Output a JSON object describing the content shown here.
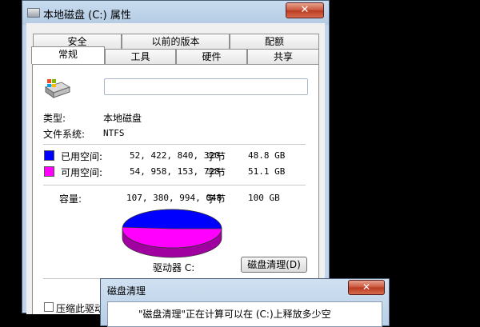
{
  "window": {
    "title": "本地磁盘 (C:) 属性",
    "close_glyph": "✕"
  },
  "tabs_row1": [
    {
      "label": "安全"
    },
    {
      "label": "以前的版本"
    },
    {
      "label": "配额"
    }
  ],
  "tabs_row2": [
    {
      "label": "常规"
    },
    {
      "label": "工具"
    },
    {
      "label": "硬件"
    },
    {
      "label": "共享"
    }
  ],
  "general": {
    "name_value": "",
    "type_label": "类型:",
    "type_value": "本地磁盘",
    "fs_label": "文件系统:",
    "fs_value": "NTFS",
    "used_label": "已用空间:",
    "used_bytes": "52, 422, 840, 320",
    "used_unit": "字节",
    "used_gb": "48.8 GB",
    "free_label": "可用空间:",
    "free_bytes": "54, 958, 153, 728",
    "free_unit": "字节",
    "free_gb": "51.1 GB",
    "capacity_label": "容量:",
    "capacity_bytes": "107, 380, 994, 048",
    "capacity_unit": "字节",
    "capacity_gb": "100 GB",
    "drive_label": "驱动器 C:",
    "cleanup_button": "磁盘清理(D)",
    "compress_label": "压缩此驱动",
    "used_color": "#0000ff",
    "free_color": "#ff00ff",
    "used_fraction": 0.488
  },
  "popup": {
    "title": "磁盘清理",
    "close_glyph": "✕",
    "message": "\"磁盘清理\"正在计算可以在 (C:)上释放多少空"
  }
}
